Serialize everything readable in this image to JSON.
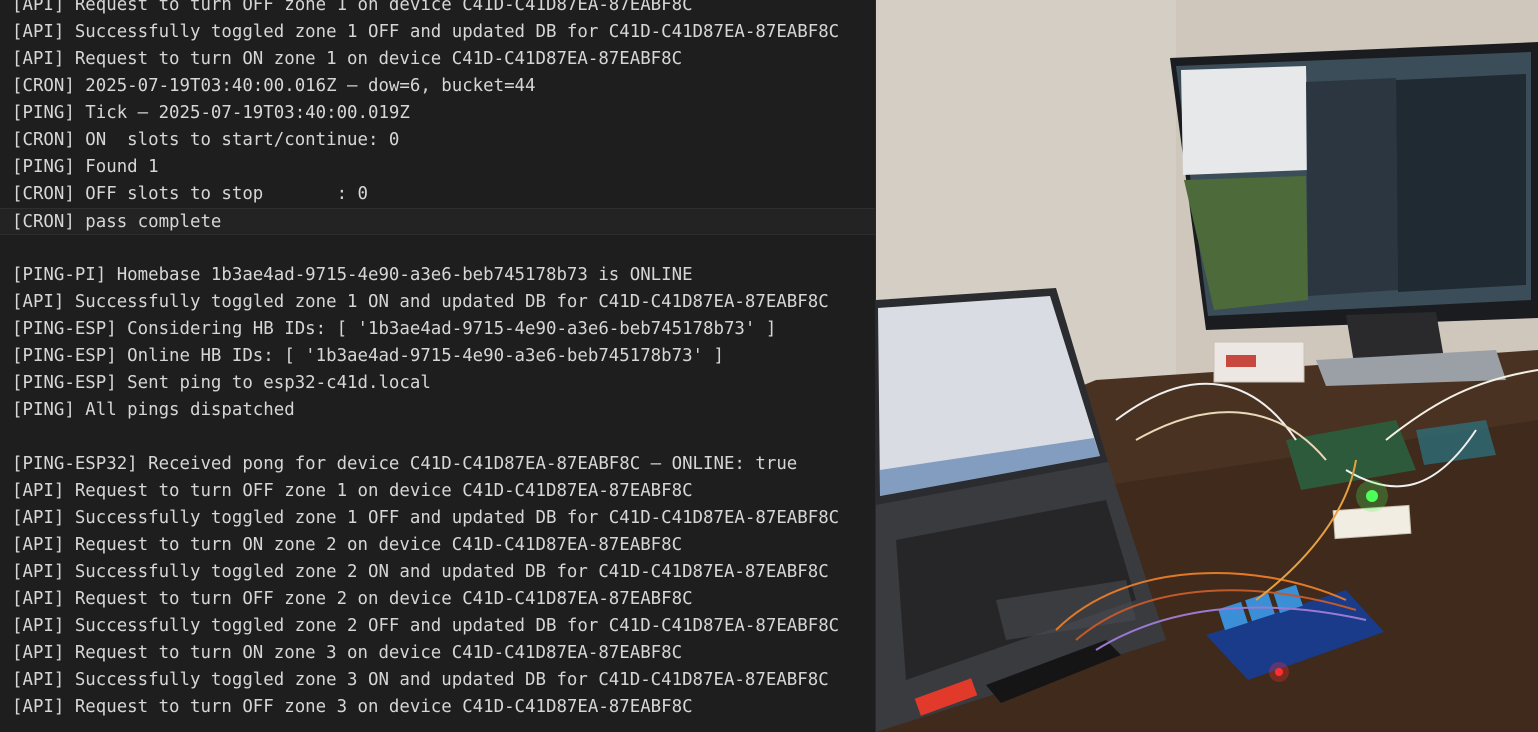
{
  "terminal": {
    "lines": [
      "[API] Request to turn OFF zone 1 on device C41D-C41D87EA-87EABF8C",
      "[API] Successfully toggled zone 1 OFF and updated DB for C41D-C41D87EA-87EABF8C",
      "[API] Request to turn ON zone 1 on device C41D-C41D87EA-87EABF8C",
      "[CRON] 2025-07-19T03:40:00.016Z — dow=6, bucket=44",
      "[PING] Tick — 2025-07-19T03:40:00.019Z",
      "[CRON] ON  slots to start/continue: 0",
      "[PING] Found 1",
      "[CRON] OFF slots to stop       : 0",
      "[CRON] pass complete",
      "",
      "[PING-PI] Homebase 1b3ae4ad-9715-4e90-a3e6-beb745178b73 is ONLINE",
      "[API] Successfully toggled zone 1 ON and updated DB for C41D-C41D87EA-87EABF8C",
      "[PING-ESP] Considering HB IDs: [ '1b3ae4ad-9715-4e90-a3e6-beb745178b73' ]",
      "[PING-ESP] Online HB IDs: [ '1b3ae4ad-9715-4e90-a3e6-beb745178b73' ]",
      "[PING-ESP] Sent ping to esp32-c41d.local",
      "[PING] All pings dispatched",
      "",
      "[PING-ESP32] Received pong for device C41D-C41D87EA-87EABF8C — ONLINE: true",
      "[API] Request to turn OFF zone 1 on device C41D-C41D87EA-87EABF8C",
      "[API] Successfully toggled zone 1 OFF and updated DB for C41D-C41D87EA-87EABF8C",
      "[API] Request to turn ON zone 2 on device C41D-C41D87EA-87EABF8C",
      "[API] Successfully toggled zone 2 ON and updated DB for C41D-C41D87EA-87EABF8C",
      "[API] Request to turn OFF zone 2 on device C41D-C41D87EA-87EABF8C",
      "[API] Successfully toggled zone 2 OFF and updated DB for C41D-C41D87EA-87EABF8C",
      "[API] Request to turn ON zone 3 on device C41D-C41D87EA-87EABF8C",
      "[API] Successfully toggled zone 3 ON and updated DB for C41D-C41D87EA-87EABF8C",
      "[API] Request to turn OFF zone 3 on device C41D-C41D87EA-87EABF8C"
    ],
    "colors": {
      "background": "#1e1e1e",
      "text": "#d6d6d6"
    }
  },
  "photo": {
    "led_colors": {
      "green": "#4cff5a",
      "red": "#ff3030"
    }
  }
}
